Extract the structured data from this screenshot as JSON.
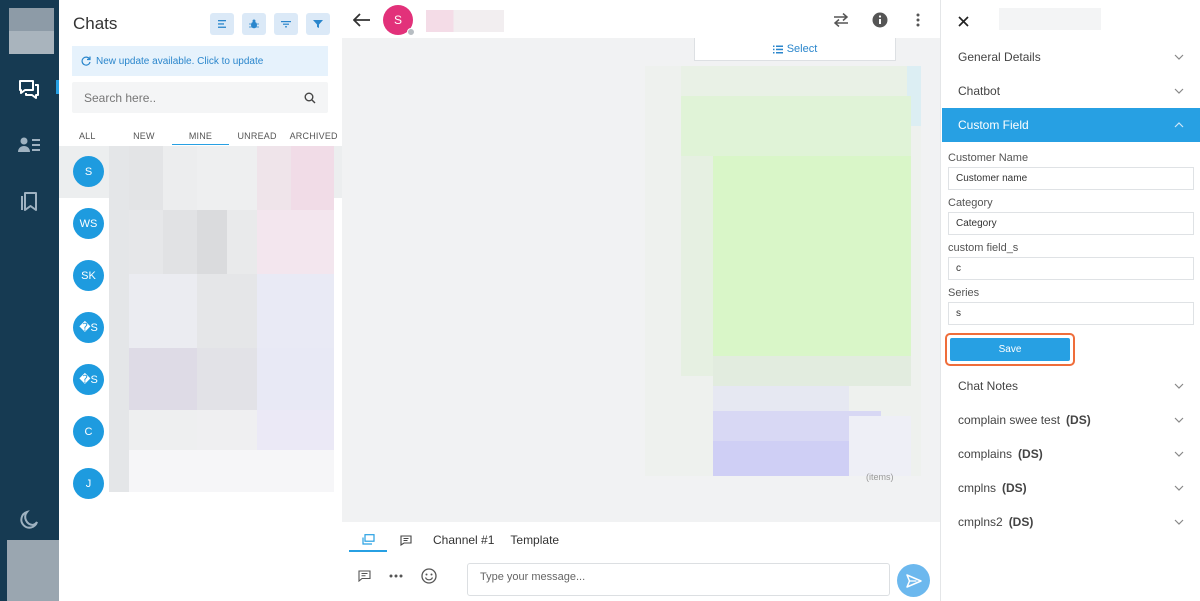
{
  "rail": {
    "icons": [
      "chat-icon",
      "contacts-icon",
      "bookmarks-icon",
      "moon-icon"
    ]
  },
  "chats": {
    "title": "Chats",
    "update_banner": "New update available. Click to update",
    "search_placeholder": "Search here..",
    "tabs": [
      "ALL",
      "NEW",
      "MINE",
      "UNREAD",
      "ARCHIVED"
    ],
    "active_tab": "MINE",
    "list": [
      {
        "initials": "S"
      },
      {
        "initials": "WS"
      },
      {
        "initials": "SK"
      },
      {
        "initials": "�S"
      },
      {
        "initials": "�S"
      },
      {
        "initials": "C"
      },
      {
        "initials": "J"
      }
    ]
  },
  "conversation": {
    "contact_initial": "S",
    "select_label": "Select",
    "items_note": "(items)",
    "composer": {
      "tabs": [
        "Channel #1",
        "Template"
      ],
      "placeholder": "Type your message..."
    }
  },
  "details": {
    "sections_top": [
      "General Details",
      "Chatbot"
    ],
    "open_section": "Custom Field",
    "fields": [
      {
        "label": "Customer Name",
        "value": "Customer name"
      },
      {
        "label": "Category",
        "value": "Category"
      },
      {
        "label": "custom field_s",
        "value": "c"
      },
      {
        "label": "Series",
        "value": "s"
      }
    ],
    "save_label": "Save",
    "sections_bottom": [
      {
        "title": "Chat Notes",
        "tag": ""
      },
      {
        "title": "complain swee test",
        "tag": "(DS)"
      },
      {
        "title": "complains",
        "tag": "(DS)"
      },
      {
        "title": "cmplns",
        "tag": "(DS)"
      },
      {
        "title": "cmplns2",
        "tag": "(DS)"
      }
    ]
  },
  "colors": {
    "accent": "#27a0e3",
    "rail": "#163a52",
    "contact_avatar": "#e2317a",
    "highlight": "#ef6d3a"
  }
}
